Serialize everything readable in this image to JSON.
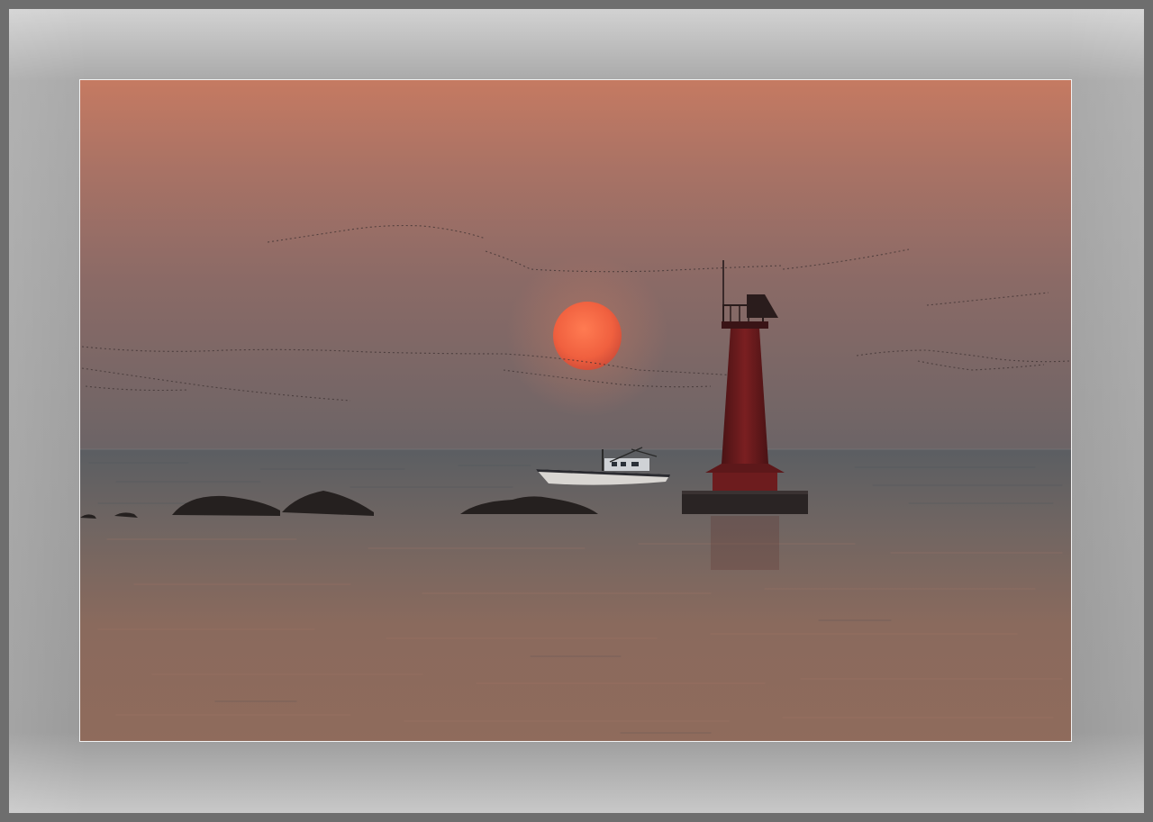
{
  "scene": {
    "subject": "sunset-over-sea-with-lighthouse",
    "colors": {
      "sky_top": "#c87a63",
      "sky_mid": "#8e6a62",
      "sky_horizon": "#6c6466",
      "sea_near": "#8d6a5c",
      "sea_far": "#5e6063",
      "sun": "#f0603f",
      "lighthouse": "#6a1a1c",
      "silhouette": "#25201f",
      "frame": "#a4a4a4"
    }
  }
}
